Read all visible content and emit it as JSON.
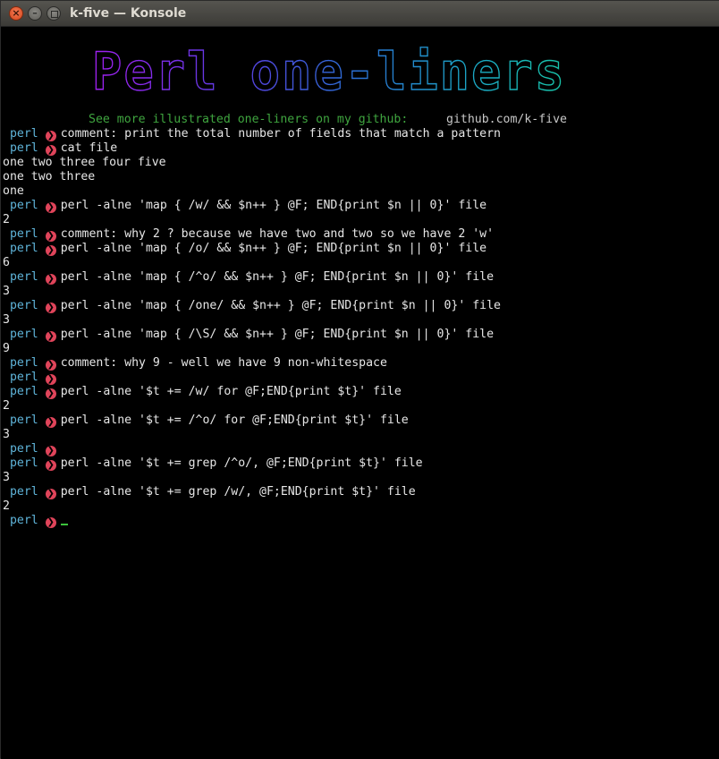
{
  "window": {
    "title": "k-five — Konsole",
    "close_glyph": "×",
    "min_glyph": "–"
  },
  "banner": {
    "title": "Perl one-liners",
    "subtitle": "See more illustrated one-liners on my github:",
    "url": "github.com/k-five",
    "colors": [
      "#a020f0",
      "#5a3de0",
      "#2b6fd6",
      "#1ba6c4",
      "#18c4a8"
    ]
  },
  "prompt": {
    "word": "perl",
    "arrow": "❯",
    "accent_color": "#e0445a",
    "word_color": "#5fb4d9"
  },
  "lines": [
    {
      "type": "prompt",
      "text": "comment: print the total number of fields that match a pattern"
    },
    {
      "type": "prompt",
      "text": "cat file"
    },
    {
      "type": "output",
      "text": "one two three four five"
    },
    {
      "type": "output",
      "text": "one two three"
    },
    {
      "type": "output",
      "text": "one"
    },
    {
      "type": "prompt",
      "text": "perl -alne 'map { /w/ && $n++ } @F; END{print $n || 0}' file"
    },
    {
      "type": "output",
      "text": "2"
    },
    {
      "type": "prompt",
      "text": "comment: why 2 ? because we have two and two so we have 2 'w'"
    },
    {
      "type": "prompt",
      "text": "perl -alne 'map { /o/ && $n++ } @F; END{print $n || 0}' file"
    },
    {
      "type": "output",
      "text": "6"
    },
    {
      "type": "prompt",
      "text": "perl -alne 'map { /^o/ && $n++ } @F; END{print $n || 0}' file"
    },
    {
      "type": "output",
      "text": "3"
    },
    {
      "type": "prompt",
      "text": "perl -alne 'map { /one/ && $n++ } @F; END{print $n || 0}' file"
    },
    {
      "type": "output",
      "text": "3"
    },
    {
      "type": "prompt",
      "text": "perl -alne 'map { /\\S/ && $n++ } @F; END{print $n || 0}' file"
    },
    {
      "type": "output",
      "text": "9"
    },
    {
      "type": "prompt",
      "text": "comment: why 9 - well we have 9 non-whitespace"
    },
    {
      "type": "prompt",
      "text": ""
    },
    {
      "type": "prompt",
      "text": "perl -alne '$t += /w/ for @F;END{print $t}' file"
    },
    {
      "type": "output",
      "text": "2"
    },
    {
      "type": "prompt",
      "text": "perl -alne '$t += /^o/ for @F;END{print $t}' file"
    },
    {
      "type": "output",
      "text": "3"
    },
    {
      "type": "prompt",
      "text": ""
    },
    {
      "type": "prompt",
      "text": "perl -alne '$t += grep /^o/, @F;END{print $t}' file"
    },
    {
      "type": "output",
      "text": "3"
    },
    {
      "type": "prompt",
      "text": "perl -alne '$t += grep /w/, @F;END{print $t}' file"
    },
    {
      "type": "output",
      "text": "2"
    },
    {
      "type": "prompt",
      "text": "",
      "cursor": true
    }
  ]
}
